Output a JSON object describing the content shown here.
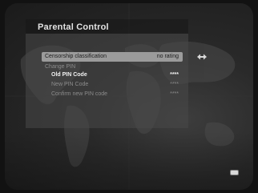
{
  "menu": {
    "title": "Parental Control",
    "items": [
      {
        "label": "Censorship classification",
        "value": "no rating",
        "state": "selected"
      },
      {
        "label": "Change PIN",
        "value": "",
        "state": "dim"
      },
      {
        "label": "Old PIN Code",
        "value": "****",
        "state": "active"
      },
      {
        "label": "New PIN Code",
        "value": "****",
        "state": "dim"
      },
      {
        "label": "Confirm new PIN code",
        "value": "****",
        "state": "dim"
      }
    ]
  },
  "icons": {
    "adjust_arrows": "left-right-arrows-icon",
    "ok_button": "ok-button-icon"
  },
  "colors": {
    "selected_row": "#9b9b9b",
    "panel": "#484848",
    "text": "#e3e3e3"
  }
}
